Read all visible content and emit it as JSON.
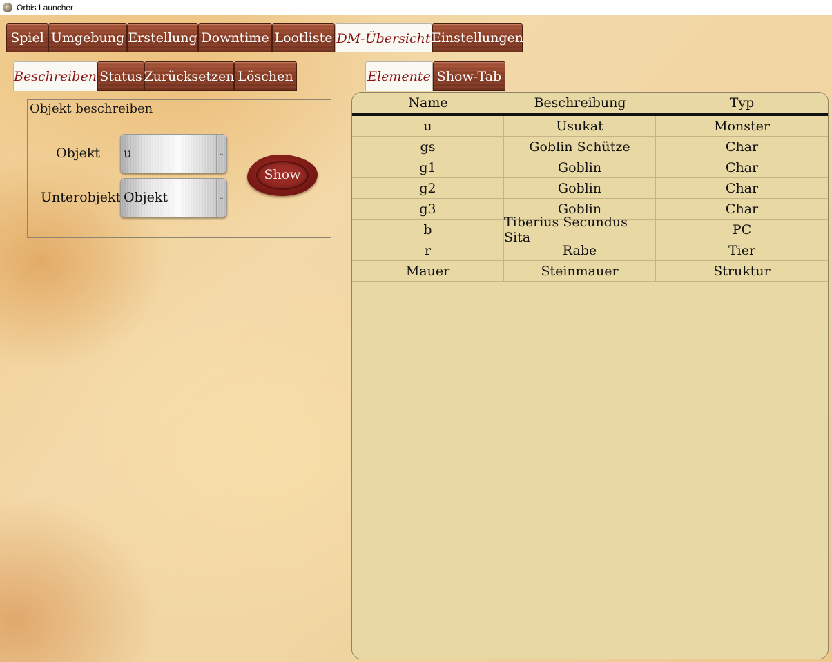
{
  "window": {
    "title": "Orbis Launcher"
  },
  "main_tabs": [
    {
      "label": "Spiel",
      "active": false
    },
    {
      "label": "Umgebung",
      "active": false
    },
    {
      "label": "Erstellung",
      "active": false
    },
    {
      "label": "Downtime",
      "active": false
    },
    {
      "label": "Lootliste",
      "active": false
    },
    {
      "label": "DM-Übersicht",
      "active": true
    },
    {
      "label": "Einstellungen",
      "active": false
    }
  ],
  "left_tabs": [
    {
      "label": "Beschreiben",
      "active": true
    },
    {
      "label": "Status",
      "active": false
    },
    {
      "label": "Zurücksetzen",
      "active": false
    },
    {
      "label": "Löschen",
      "active": false
    }
  ],
  "right_tabs": [
    {
      "label": "Elemente",
      "active": true
    },
    {
      "label": "Show-Tab",
      "active": false
    }
  ],
  "describe_group": {
    "title": "Objekt beschreiben",
    "object_label": "Objekt",
    "object_value": "u",
    "subobject_label": "Unterobjekt",
    "subobject_value": "Objekt",
    "show_button": "Show"
  },
  "elements_table": {
    "columns": [
      "Name",
      "Beschreibung",
      "Typ"
    ],
    "rows": [
      [
        "u",
        "Usukat",
        "Monster"
      ],
      [
        "gs",
        "Goblin Schütze",
        "Char"
      ],
      [
        "g1",
        "Goblin",
        "Char"
      ],
      [
        "g2",
        "Goblin",
        "Char"
      ],
      [
        "g3",
        "Goblin",
        "Char"
      ],
      [
        "b",
        "Tiberius Secundus Sita",
        "PC"
      ],
      [
        "r",
        "Rabe",
        "Tier"
      ],
      [
        "Mauer",
        "Steinmauer",
        "Struktur"
      ]
    ]
  }
}
